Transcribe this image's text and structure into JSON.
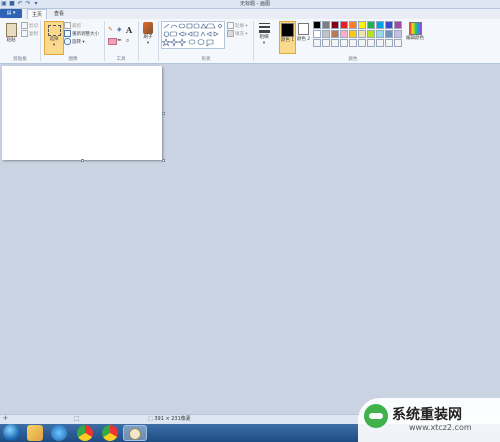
{
  "window": {
    "title": "无标题 - 画图"
  },
  "quick_access": [
    {
      "icon": "app-icon"
    },
    {
      "icon": "save-icon"
    },
    {
      "icon": "undo-icon"
    },
    {
      "icon": "redo-icon"
    },
    {
      "icon": "dropdown-icon"
    }
  ],
  "tabs": {
    "menu": "",
    "home": "主页",
    "view": "查看"
  },
  "ribbon": {
    "clipboard": {
      "label": "剪贴板",
      "paste": "粘贴",
      "cut": "剪切",
      "copy": "复制"
    },
    "image": {
      "label": "图像",
      "select": "选择",
      "crop": "裁剪",
      "resize": "重新调整大小",
      "rotate": "旋转"
    },
    "tools": {
      "label": "工具"
    },
    "brushes": {
      "label": "刷子"
    },
    "shapes": {
      "label": "形状",
      "outline": "轮廓",
      "fill": "填充"
    },
    "size": {
      "label": "粗细"
    },
    "colors": {
      "label": "颜色",
      "color1": "颜色 1",
      "color2": "颜色 2",
      "edit": "编辑颜色",
      "palette_row1": [
        "#000000",
        "#7f7f7f",
        "#880015",
        "#ed1c24",
        "#ff7f27",
        "#fff200",
        "#22b14c",
        "#00a2e8",
        "#3f48cc",
        "#a349a4"
      ],
      "palette_row2": [
        "#ffffff",
        "#c3c3c3",
        "#b97a57",
        "#ffaec9",
        "#ffc90e",
        "#efe4b0",
        "#b5e61d",
        "#99d9ea",
        "#7092be",
        "#c8bfe7"
      ],
      "palette_row3": [
        "#f4f4f4",
        "#f4f4f4",
        "#f4f4f4",
        "#f4f4f4",
        "#f4f4f4",
        "#f4f4f4",
        "#f4f4f4",
        "#f4f4f4",
        "#f4f4f4",
        "#f4f4f4"
      ]
    }
  },
  "status": {
    "canvas_size": "391 × 231像素"
  },
  "taskbar": {
    "apps": [
      "start-orb",
      "folder-app",
      "ie-app",
      "chrome-app-1",
      "chrome-app-2",
      "paint-app"
    ]
  },
  "watermark": {
    "title": "系统重装网",
    "url": "www.xtcz2.com"
  }
}
